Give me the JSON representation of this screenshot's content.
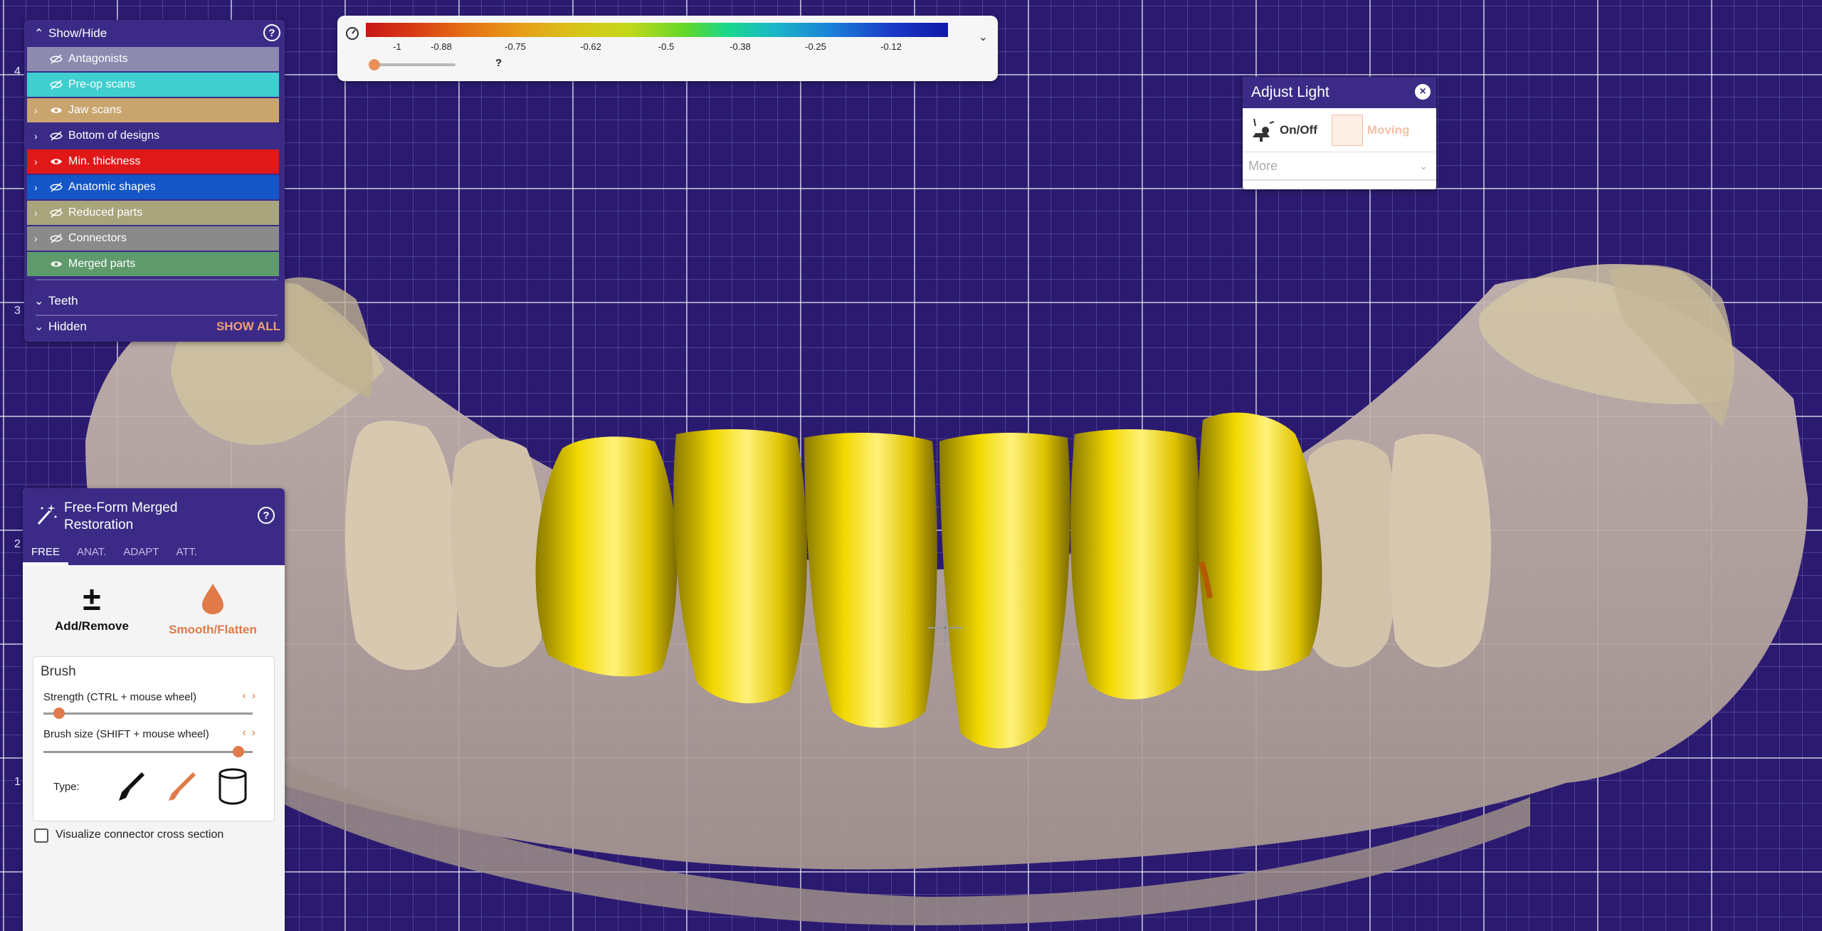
{
  "ruler": {
    "labels": [
      "4",
      "3",
      "2",
      "1"
    ]
  },
  "show_hide": {
    "title": "Show/Hide",
    "layers": [
      {
        "label": "Antagonists",
        "color": "#8d8ab0",
        "visible": false,
        "expandable": false
      },
      {
        "label": "Pre-op scans",
        "color": "#3fcfcf",
        "visible": false,
        "expandable": false
      },
      {
        "label": "Jaw scans",
        "color": "#c8a56e",
        "visible": true,
        "expandable": true
      },
      {
        "label": "Bottom of designs",
        "color": "#3c2b86",
        "visible": false,
        "expandable": true
      },
      {
        "label": "Min. thickness",
        "color": "#e01818",
        "visible": true,
        "expandable": true
      },
      {
        "label": "Anatomic shapes",
        "color": "#1455c8",
        "visible": false,
        "expandable": true
      },
      {
        "label": "Reduced parts",
        "color": "#a8a47c",
        "visible": false,
        "expandable": true
      },
      {
        "label": "Connectors",
        "color": "#8a8a8a",
        "visible": false,
        "expandable": true
      },
      {
        "label": "Merged parts",
        "color": "#5e9a6c",
        "visible": true,
        "expandable": false
      }
    ],
    "teeth_label": "Teeth",
    "hidden_label": "Hidden",
    "show_all_label": "SHOW ALL"
  },
  "scale_bar": {
    "ticks": [
      "-1",
      "-0.88",
      "-0.75",
      "-0.62",
      "-0.5",
      "-0.38",
      "-0.25",
      "-0.12"
    ],
    "question": "?"
  },
  "adjust_light": {
    "title": "Adjust Light",
    "on_off_label": "On/Off",
    "moving_label": "Moving",
    "more_label": "More"
  },
  "freeform": {
    "title": "Free-Form Merged Restoration",
    "tabs": [
      "FREE",
      "ANAT.",
      "ADAPT",
      "ATT."
    ],
    "active_tab": "FREE",
    "tools": [
      {
        "label": "Add/Remove",
        "color": "#111111"
      },
      {
        "label": "Smooth/Flatten",
        "color": "#e07a4a"
      }
    ],
    "brush": {
      "title": "Brush",
      "strength_label": "Strength (CTRL + mouse wheel)",
      "strength_value": 0.07,
      "size_label": "Brush size (SHIFT + mouse wheel)",
      "size_value": 0.93,
      "type_label": "Type:"
    },
    "visualize_label": "Visualize connector cross section",
    "visualize_checked": false
  }
}
